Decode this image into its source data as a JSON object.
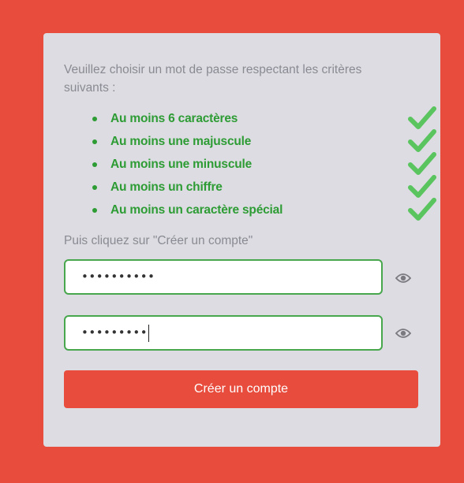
{
  "intro_text": "Veuillez choisir un mot de passe respectant les critères suivants :",
  "criteria": [
    {
      "label": "Au moins 6 caractères",
      "icon": "check-icon",
      "met": true
    },
    {
      "label": "Au moins une majuscule",
      "icon": "check-icon",
      "met": true
    },
    {
      "label": "Au moins une minuscule",
      "icon": "check-icon",
      "met": true
    },
    {
      "label": "Au moins un chiffre",
      "icon": "check-icon",
      "met": true
    },
    {
      "label": "Au moins un caractère spécial",
      "icon": "check-icon",
      "met": true
    }
  ],
  "instruction": "Puis cliquez sur \"Créer un compte\"",
  "password_field": {
    "masked_value": "••••••••••",
    "toggle_icon": "eye-icon"
  },
  "confirm_field": {
    "masked_value": "•••••••••",
    "toggle_icon": "eye-icon",
    "focused": true
  },
  "create_button_label": "Créer un compte",
  "colors": {
    "page_background": "#e84c3d",
    "card_background": "#dcdce2",
    "criteria_met": "#2e9c34",
    "check": "#5ac45e",
    "field_border": "#48a64d",
    "button": "#e84c3d",
    "muted_text": "#8a8a93"
  }
}
